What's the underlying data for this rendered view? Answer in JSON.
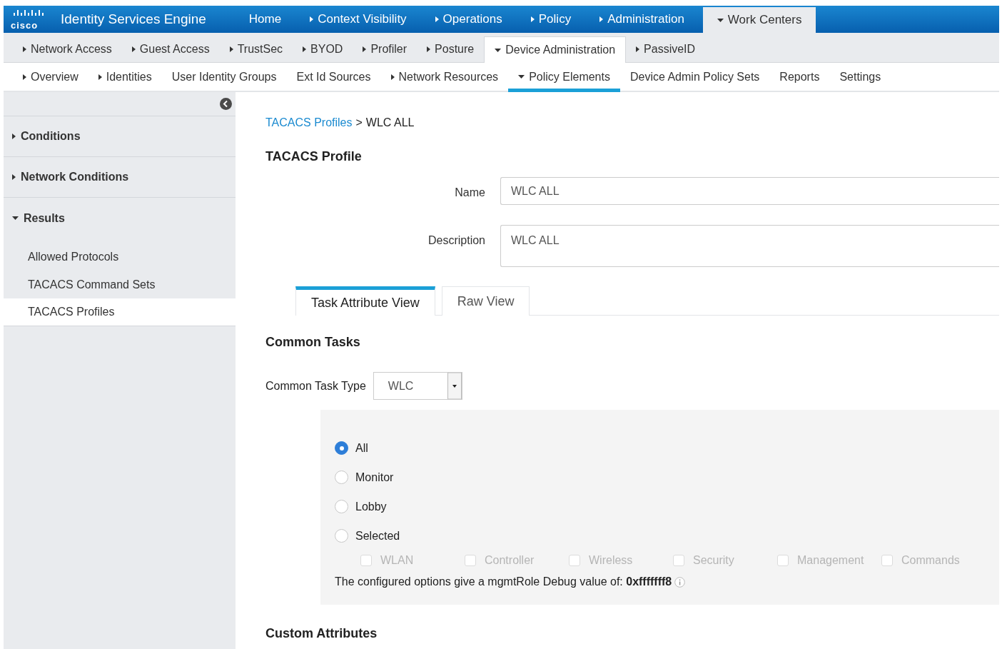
{
  "brand": {
    "logo": "cisco",
    "title": "Identity Services Engine"
  },
  "top_nav": [
    {
      "label": "Home",
      "kind": "plain",
      "selected": false
    },
    {
      "label": "Context Visibility",
      "kind": "collapsed",
      "selected": false
    },
    {
      "label": "Operations",
      "kind": "collapsed",
      "selected": false
    },
    {
      "label": "Policy",
      "kind": "collapsed",
      "selected": false
    },
    {
      "label": "Administration",
      "kind": "collapsed",
      "selected": false
    },
    {
      "label": "Work Centers",
      "kind": "expanded",
      "selected": true
    }
  ],
  "sub_nav": [
    {
      "label": "Network Access",
      "kind": "collapsed",
      "selected": false
    },
    {
      "label": "Guest Access",
      "kind": "collapsed",
      "selected": false
    },
    {
      "label": "TrustSec",
      "kind": "collapsed",
      "selected": false
    },
    {
      "label": "BYOD",
      "kind": "collapsed",
      "selected": false
    },
    {
      "label": "Profiler",
      "kind": "collapsed",
      "selected": false
    },
    {
      "label": "Posture",
      "kind": "collapsed",
      "selected": false
    },
    {
      "label": "Device Administration",
      "kind": "expanded",
      "selected": true
    },
    {
      "label": "PassiveID",
      "kind": "collapsed",
      "selected": false
    }
  ],
  "third_nav": [
    {
      "label": "Overview",
      "kind": "collapsed",
      "selected": false
    },
    {
      "label": "Identities",
      "kind": "collapsed",
      "selected": false
    },
    {
      "label": "User Identity Groups",
      "kind": "plain",
      "selected": false
    },
    {
      "label": "Ext Id Sources",
      "kind": "plain",
      "selected": false
    },
    {
      "label": "Network Resources",
      "kind": "collapsed",
      "selected": false
    },
    {
      "label": "Policy Elements",
      "kind": "expanded",
      "selected": true
    },
    {
      "label": "Device Admin Policy Sets",
      "kind": "plain",
      "selected": false
    },
    {
      "label": "Reports",
      "kind": "plain",
      "selected": false
    },
    {
      "label": "Settings",
      "kind": "plain",
      "selected": false
    }
  ],
  "sidebar": {
    "sections": [
      {
        "label": "Conditions",
        "expanded": false
      },
      {
        "label": "Network Conditions",
        "expanded": false
      },
      {
        "label": "Results",
        "expanded": true,
        "children": [
          {
            "label": "Allowed Protocols",
            "selected": false
          },
          {
            "label": "TACACS Command Sets",
            "selected": false
          },
          {
            "label": "TACACS Profiles",
            "selected": true
          }
        ]
      }
    ]
  },
  "breadcrumb": {
    "link": "TACACS Profiles",
    "separator": ">",
    "current": "WLC ALL"
  },
  "heading": "TACACS Profile",
  "fields": [
    {
      "label": "Name",
      "value": "WLC ALL",
      "kind": "input"
    },
    {
      "label": "Description",
      "value": "WLC ALL",
      "kind": "textarea"
    }
  ],
  "view_tabs": [
    {
      "label": "Task Attribute View",
      "selected": true
    },
    {
      "label": "Raw View",
      "selected": false
    }
  ],
  "common_tasks": {
    "heading": "Common Tasks",
    "type_label": "Common Task Type",
    "type_value": "WLC",
    "radios": [
      {
        "label": "All",
        "selected": true
      },
      {
        "label": "Monitor",
        "selected": false
      },
      {
        "label": "Lobby",
        "selected": false
      },
      {
        "label": "Selected",
        "selected": false
      }
    ],
    "checkboxes": [
      {
        "label": "WLAN",
        "checked": false,
        "disabled": true
      },
      {
        "label": "Controller",
        "checked": false,
        "disabled": true
      },
      {
        "label": "Wireless",
        "checked": false,
        "disabled": true
      },
      {
        "label": "Security",
        "checked": false,
        "disabled": true
      },
      {
        "label": "Management",
        "checked": false,
        "disabled": true
      },
      {
        "label": "Commands",
        "checked": false,
        "disabled": true
      }
    ],
    "debug_text": "The configured options give a mgmtRole Debug value of: **0xfffffff8**"
  },
  "custom_heading": "Custom Attributes"
}
